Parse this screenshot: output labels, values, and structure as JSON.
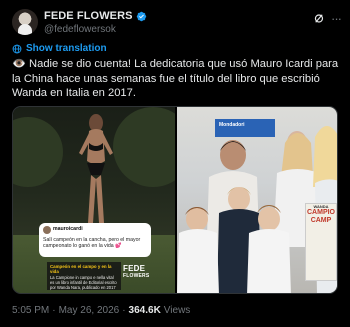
{
  "header": {
    "display_name": "FEDE FLOWERS",
    "handle": "@fedeflowersok",
    "icons": [
      "verified-badge-icon",
      "grok-icon",
      "more-options-icon"
    ],
    "more_glyph": "···"
  },
  "translation": {
    "label": "Show translation",
    "icon": "globe-icon"
  },
  "tweet": {
    "text": "👁️ Nadie se dio cuenta!  La dedicatoria que usó Mauro Icardi para la China hace unas semanas fue el título del libro que escribió Wanda en Italia en 2017."
  },
  "media": {
    "left_image": {
      "card_user": "mauroicardi",
      "card_quote": "Salí campeón en la cancha, pero el mayor campeonato lo ganó en la vida 💕",
      "caption_title": "Campeón en el campo y en la vida",
      "caption_body": "La Campione in campo e nella vital es un libro infantil de Editorial escrito por Wanda Nara, publicado en 2017",
      "watermark_top": "FEDE",
      "watermark_bottom": "FLOWERS"
    },
    "right_image": {
      "brand_label": "Mondadori",
      "poster_top": "WANDA",
      "poster_title_1": "CAMPIO",
      "poster_title_2": "CAMP"
    }
  },
  "footer": {
    "time": "5:05 PM",
    "separator": "·",
    "date": "May 26, 2026",
    "views_count": "364.6K",
    "views_label": "Views"
  },
  "colors": {
    "background": "#000000",
    "text": "#e7e9ea",
    "muted": "#71767b",
    "accent": "#1d9bf0"
  }
}
